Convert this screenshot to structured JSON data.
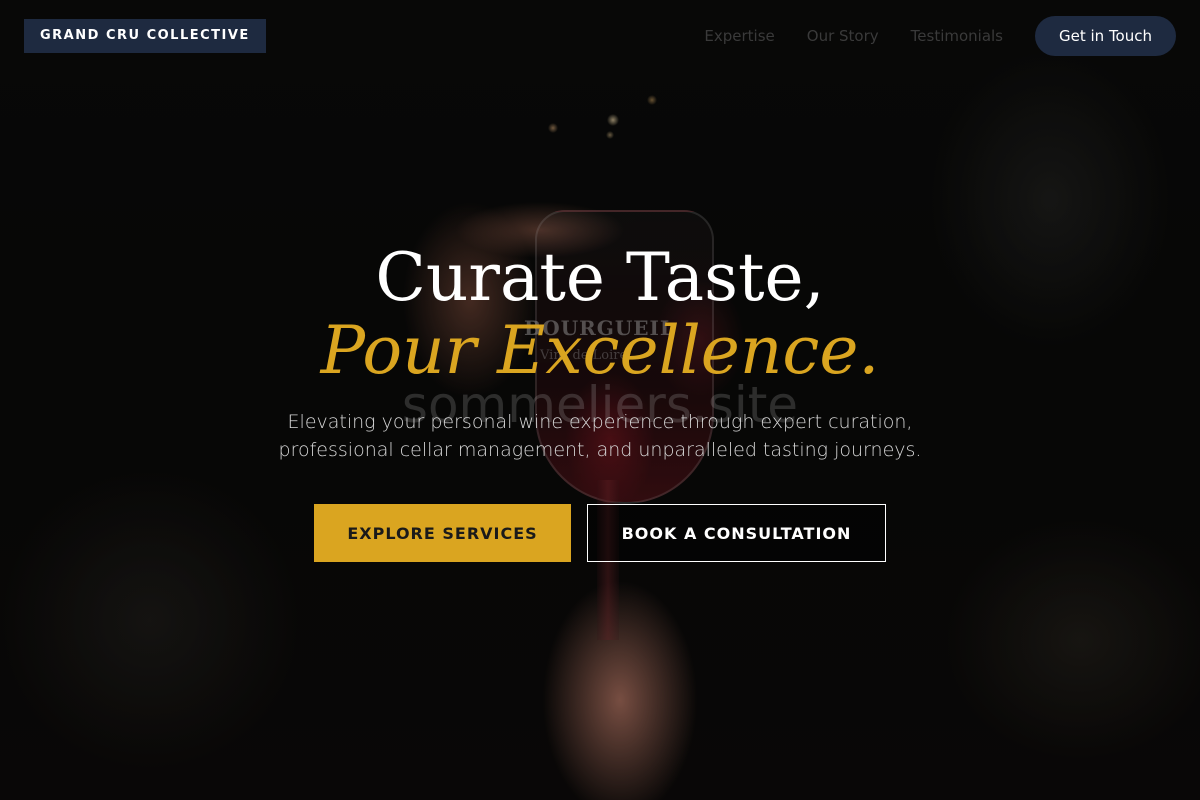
{
  "header": {
    "brand": "GRAND CRU COLLECTIVE",
    "nav": {
      "expertise": "Expertise",
      "our_story": "Our Story",
      "testimonials": "Testimonials"
    },
    "cta": "Get in Touch"
  },
  "hero": {
    "headline_line1": "Curate Taste,",
    "headline_line2": "Pour Excellence.",
    "subtext_line1": "Elevating your personal wine experience through expert curation,",
    "subtext_line2": "professional cellar management, and unparalleled tasting journeys.",
    "primary_button": "EXPLORE SERVICES",
    "secondary_button": "BOOK A CONSULTATION",
    "watermark": "sommeliers.site"
  },
  "background_photo": {
    "glass_text_line1": "BOURGUEIL",
    "glass_text_line2": "Vins de Loire"
  },
  "colors": {
    "accent_gold": "#daa520",
    "navy": "#1e2a40",
    "background": "#070707"
  }
}
